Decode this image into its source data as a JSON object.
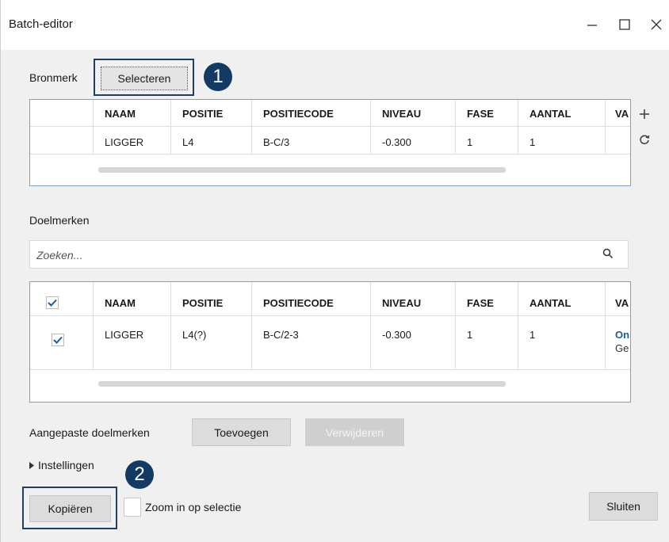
{
  "window": {
    "title": "Batch-editor"
  },
  "source": {
    "label": "Bronmerk",
    "select_button": "Selecteren",
    "columns": [
      "NAAM",
      "POSITIE",
      "POSITIECODE",
      "NIVEAU",
      "FASE",
      "AANTAL",
      "VA"
    ],
    "rows": [
      {
        "naam": "LIGGER",
        "positie": "L4",
        "positiecode": "B-C/3",
        "niveau": "-0.300",
        "fase": "1",
        "aantal": "1"
      }
    ]
  },
  "target": {
    "label": "Doelmerken",
    "search_placeholder": "Zoeken...",
    "columns": [
      "NAAM",
      "POSITIE",
      "POSITIECODE",
      "NIVEAU",
      "FASE",
      "AANTAL",
      "VA"
    ],
    "rows": [
      {
        "naam": "LIGGER",
        "positie": "L4(?)",
        "positiecode": "B-C/2-3",
        "niveau": "-0.300",
        "fase": "1",
        "aantal": "1",
        "va_line1": "On",
        "va_line2": "Ge"
      }
    ]
  },
  "custom_targets": {
    "label": "Aangepaste doelmerken",
    "add_button": "Toevoegen",
    "remove_button": "Verwijderen"
  },
  "settings": {
    "label": "Instellingen"
  },
  "footer": {
    "copy_button": "Kopiëren",
    "zoom_label": "Zoom in op selectie",
    "close_button": "Sluiten"
  },
  "callouts": [
    "1",
    "2"
  ],
  "colors": {
    "callout": "#133a63",
    "link": "#1f5c99"
  }
}
